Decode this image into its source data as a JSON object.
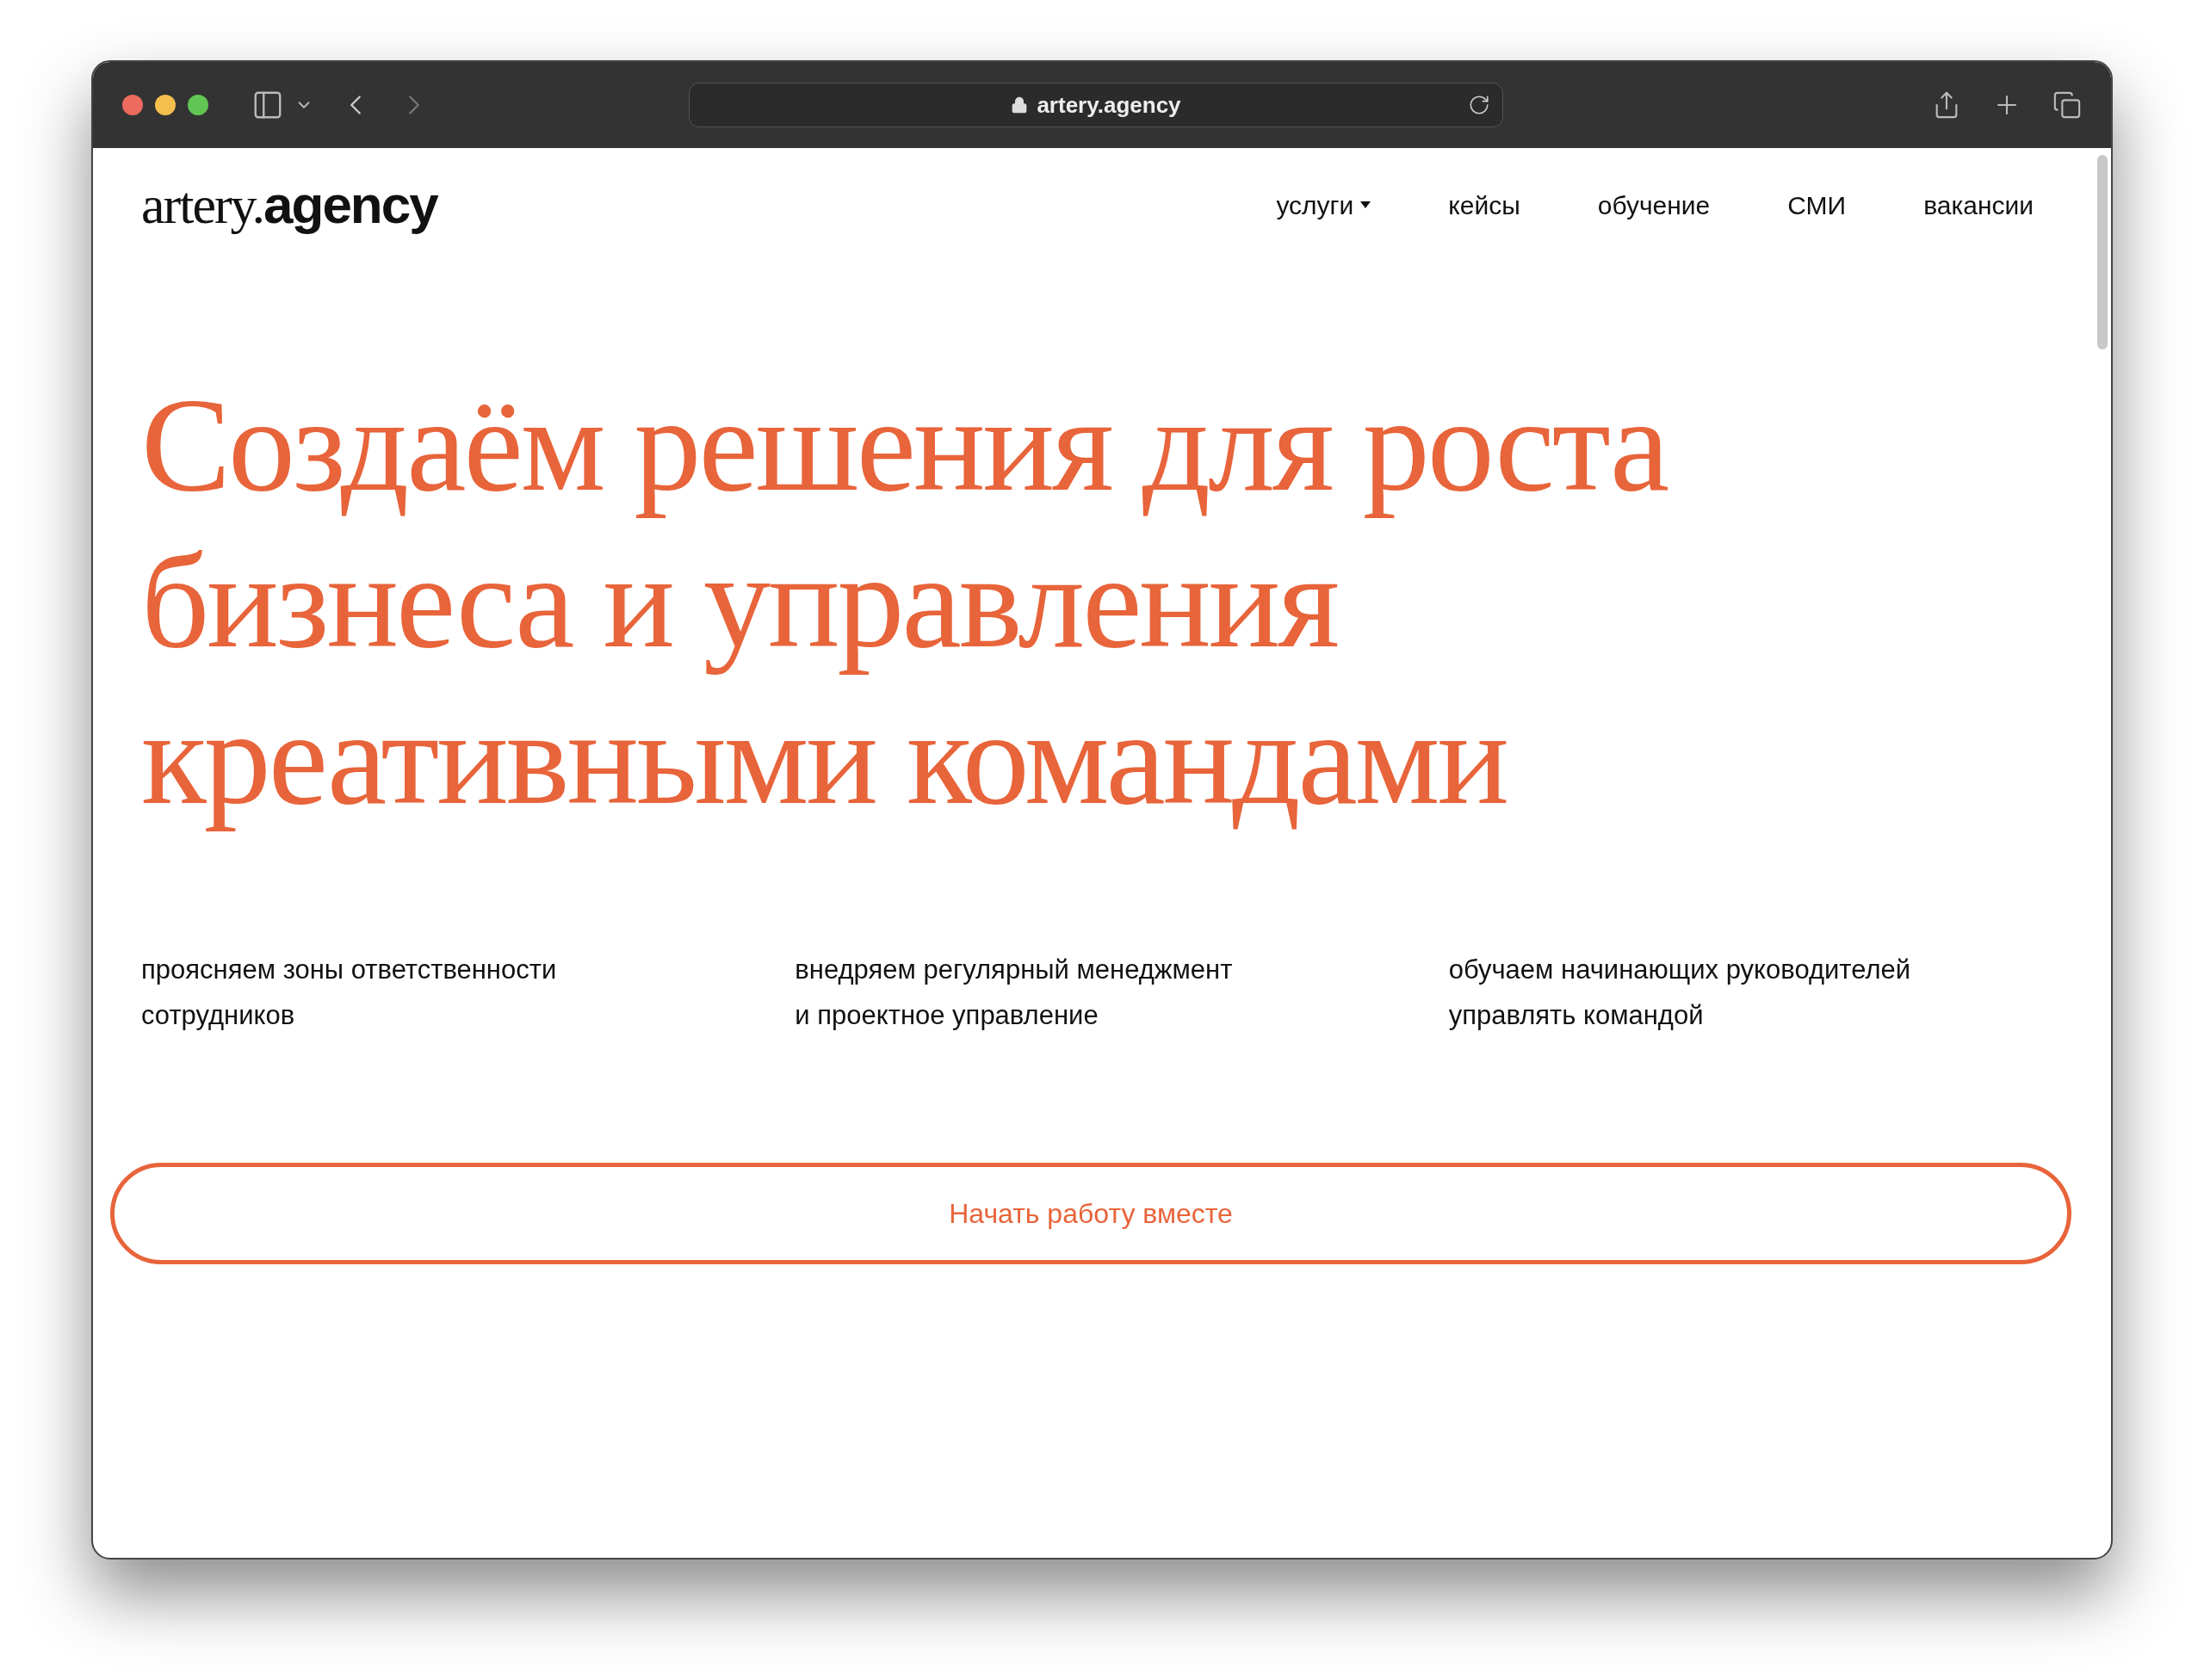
{
  "browser": {
    "url": "artery.agency"
  },
  "header": {
    "logo": {
      "light": "artery.",
      "bold": "agency"
    },
    "nav": [
      {
        "label": "услуги",
        "dropdown": true
      },
      {
        "label": "кейсы",
        "dropdown": false
      },
      {
        "label": "обучение",
        "dropdown": false
      },
      {
        "label": "СМИ",
        "dropdown": false
      },
      {
        "label": "вакансии",
        "dropdown": false
      }
    ]
  },
  "hero": {
    "headline_lines": [
      "Создаём решения для роста",
      "бизнеса и управления",
      "креативными командами"
    ],
    "points": [
      [
        "проясняем зоны ответственности",
        "сотрудников"
      ],
      [
        "внедряем регулярный менеджмент",
        "и проектное управление"
      ],
      [
        "обучаем начинающих руководителей",
        "управлять командой"
      ]
    ],
    "cta": "Начать работу вместе"
  }
}
